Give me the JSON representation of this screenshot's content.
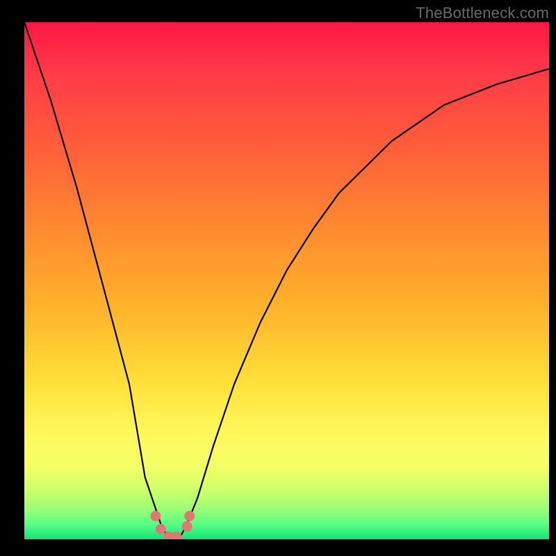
{
  "watermark": "TheBottleneck.com",
  "chart_data": {
    "type": "line",
    "title": "",
    "xlabel": "",
    "ylabel": "",
    "xlim": [
      0,
      100
    ],
    "ylim": [
      0,
      100
    ],
    "background_gradient": {
      "top_color": "#ff1744",
      "bottom_color": "#14e27a"
    },
    "series": [
      {
        "name": "bottleneck-curve",
        "x": [
          0,
          5,
          10,
          15,
          20,
          23,
          26,
          27,
          28,
          29,
          30,
          31,
          33,
          36,
          40,
          45,
          50,
          55,
          60,
          70,
          80,
          90,
          100
        ],
        "y": [
          100,
          85,
          68,
          49,
          30,
          12,
          3,
          1,
          0,
          0,
          1,
          3,
          8,
          18,
          30,
          42,
          52,
          60,
          67,
          77,
          84,
          88,
          91
        ]
      }
    ],
    "markers": {
      "name": "near-minimum-dots",
      "x": [
        25.0,
        26.0,
        27.5,
        29.0,
        31.0,
        31.5
      ],
      "y": [
        4.5,
        2.0,
        0.5,
        0.5,
        2.5,
        4.5
      ]
    }
  }
}
